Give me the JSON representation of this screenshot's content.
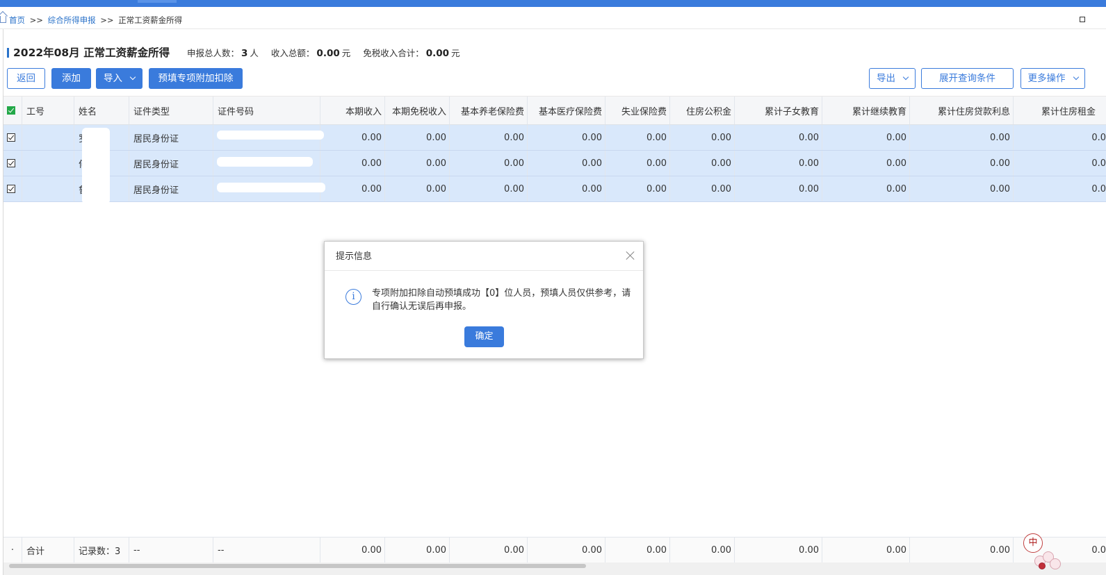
{
  "breadcrumb": {
    "home": "首页",
    "sep": ">>",
    "parent": "综合所得申报",
    "current": "正常工资薪金所得"
  },
  "header": {
    "title": "2022年08月 正常工资薪金所得",
    "count_label": "申报总人数：",
    "count_value": "3",
    "count_unit": "人",
    "income_label": "收入总额：",
    "income_value": "0.00",
    "income_unit": "元",
    "exempt_label": "免税收入合计：",
    "exempt_value": "0.00",
    "exempt_unit": "元"
  },
  "toolbar": {
    "back": "返回",
    "add": "添加",
    "import": "导入",
    "prefill": "预填专项附加扣除",
    "export": "导出",
    "expand_query": "展开查询条件",
    "more": "更多操作"
  },
  "table": {
    "columns": [
      "工号",
      "姓名",
      "证件类型",
      "证件号码",
      "本期收入",
      "本期免税收入",
      "基本养老保险费",
      "基本医疗保险费",
      "失业保险费",
      "住房公积金",
      "累计子女教育",
      "累计继续教育",
      "累计住房贷款利息",
      "累计住房租金"
    ],
    "rows": [
      {
        "name": "罗",
        "id_type": "居民身份证",
        "id_no": "",
        "values": [
          "0.00",
          "0.00",
          "0.00",
          "0.00",
          "0.00",
          "0.00",
          "0.00",
          "0.00",
          "0.00",
          "0.0"
        ]
      },
      {
        "name": "何",
        "id_type": "居民身份证",
        "id_no": "",
        "values": [
          "0.00",
          "0.00",
          "0.00",
          "0.00",
          "0.00",
          "0.00",
          "0.00",
          "0.00",
          "0.00",
          "0.0"
        ]
      },
      {
        "name": "鲁",
        "id_type": "居民身份证",
        "id_no": "",
        "values": [
          "0.00",
          "0.00",
          "0.00",
          "0.00",
          "0.00",
          "0.00",
          "0.00",
          "0.00",
          "0.00",
          "0.0"
        ]
      }
    ],
    "footer": {
      "dot": "·",
      "total": "合计",
      "records": "记录数：3",
      "dash1": "--",
      "dash2": "--",
      "values": [
        "0.00",
        "0.00",
        "0.00",
        "0.00",
        "0.00",
        "0.00",
        "0.00",
        "0.00",
        "0.00",
        "0.0"
      ]
    }
  },
  "dialog": {
    "title": "提示信息",
    "message": "专项附加扣除自动预填成功【0】位人员，预填人员仅供参考，请自行确认无误后再申报。",
    "ok": "确定"
  },
  "ime": {
    "label": "中"
  },
  "colors": {
    "accent": "#3a7bdc",
    "row_selected": "#d9e8fb",
    "check_green": "#23a848"
  }
}
